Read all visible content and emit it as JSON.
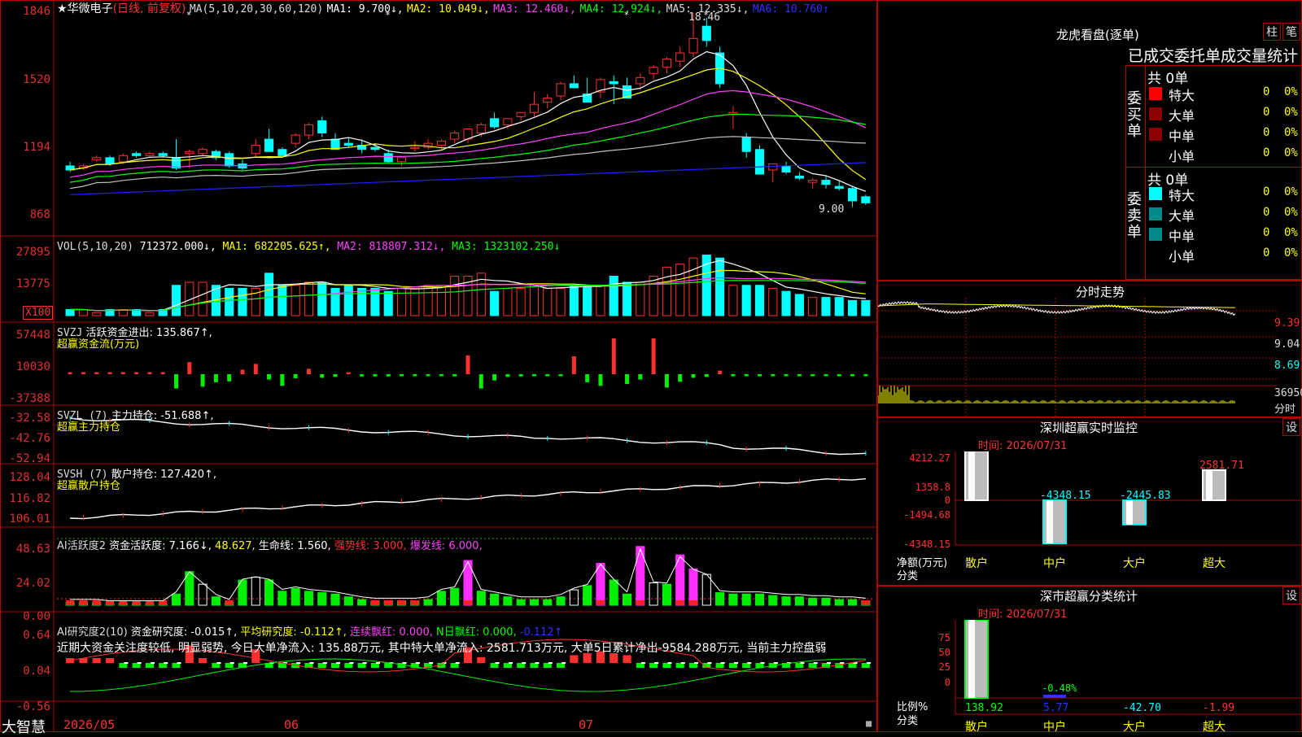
{
  "colors": {
    "up": "#ff3030",
    "down": "#00ffff",
    "grid": "#b00000",
    "axis": "#e03030",
    "text": "#dddddd",
    "ma1": "#ffffff",
    "ma2": "#ffff00",
    "ma3": "#ff40ff",
    "ma4": "#00ff00",
    "ma5": "#c0c0c0",
    "ma6": "#2020ff",
    "green": "#00ee00",
    "magenta": "#ff30ff"
  },
  "header": {
    "star": "★",
    "stock_name": "华微电子",
    "mode": "(日线, 前复权)",
    "ma_label": "MA(5,10,20,30,60,120)",
    "ma1": "MA1: 9.700↓,",
    "ma2": "MA2: 10.049↓,",
    "ma3": "MA3: 12.460↓,",
    "ma4": "MA4: 12.924↓,",
    "ma5": "MA5: 12.335↓,",
    "ma6": "MA6: 10.760↑"
  },
  "price_axis": [
    "1846",
    "1520",
    "1194",
    "868"
  ],
  "price_annotations": {
    "high": "18.46",
    "low": "9.00"
  },
  "vol": {
    "label": "VOL(5,10,20)",
    "value": "712372.000↓,",
    "ma1": "MA1: 682205.625↑,",
    "ma2": "MA2: 818807.312↓,",
    "ma3": "MA3: 1323102.250↓",
    "axis": [
      "27895",
      "13775"
    ],
    "unit": "X100"
  },
  "svzj": {
    "label": "SVZJ",
    "line1": "活跃资金进出: 135.867↑,",
    "line2": "超赢资金流(万元)",
    "axis": [
      "57448",
      "10030",
      "-37388"
    ]
  },
  "svzl": {
    "label": "SVZL (7)",
    "line1": "主力持仓: -51.688↑,",
    "line2": "超赢主力持仓",
    "axis": [
      "-32.58",
      "-42.76",
      "-52.94"
    ]
  },
  "svsh": {
    "label": "SVSH (7)",
    "line1": "散户持仓: 127.420↑,",
    "line2": "超赢散户持仓",
    "axis": [
      "128.04",
      "116.82",
      "106.01"
    ]
  },
  "ai1": {
    "label": "AI活跃度2",
    "a": "资金活跃度: 7.166↓,",
    "b": "48.627,",
    "c": "生命线: 1.560,",
    "d": "强势线: 3.000,",
    "e": "爆发线: 6.000,",
    "axis": [
      "48.63",
      "24.02",
      "0.00"
    ]
  },
  "ai2": {
    "label": "AI研究度2(10)",
    "a": "资金研究度: -0.015↑,",
    "b": "平均研究度: -0.112↑,",
    "c": "连续飘红: 0.000,",
    "d": "N日飘红: 0.000,",
    "e": "-0.112↑",
    "comment": "近期大资金关注度较低, 明显弱势, 今日大单净流入: 135.88万元, 其中特大单净流入: 2581.713万元, 大单5日累计净出-9584.288万元, 当前主力控盘弱",
    "axis": [
      "0.64",
      "0.04",
      "-0.56"
    ]
  },
  "date_axis": {
    "d1": "2026/05",
    "d2": "06",
    "d3": "07"
  },
  "brand": "大智慧",
  "right": {
    "lhb_title": "龙虎看盘(逐单)",
    "btn1": "柱",
    "btn2": "笔",
    "tabs": "已成交委托单成交量统计",
    "buy_side": "委买单",
    "sell_side": "委卖单",
    "buy_total": "共 0单",
    "sell_total": "共 0单",
    "rows": [
      "特大",
      "大单",
      "中单",
      "小单"
    ],
    "zero": "0",
    "pct": "0%",
    "fs_title": "分时走势",
    "fs_axis": [
      "9.39",
      "9.04",
      "8.69"
    ],
    "fs_vol": "36950",
    "fs_unit": "分时",
    "sz_title": "深圳超赢实时监控",
    "sz_btn": "设",
    "sz_time": "时间: 2026/07/31",
    "sz_axis": [
      "4212.27",
      "1358.8",
      "0",
      "-1494.68",
      "-4348.15"
    ],
    "sz_values": [
      "4212.27",
      "-4348.15",
      "-2445.83",
      "2581.71"
    ],
    "sz_unit1": "净额(万元)",
    "sz_unit2": "分类",
    "cats": [
      "散户",
      "中户",
      "大户",
      "超大"
    ],
    "ss_title": "深市超赢分类统计",
    "ss_btn": "设",
    "ss_time": "时间: 2026/07/31",
    "ss_axis": [
      "75",
      "50",
      "25",
      "0"
    ],
    "ss_bar_label": "-0.48%",
    "ss_values": [
      "138.92",
      "5.77",
      "-42.70",
      "-1.99"
    ],
    "ss_unit1": "比例%",
    "ss_unit2": "分类"
  },
  "chart_data": {
    "type": "candlestick",
    "candles": [
      [
        11.0,
        11.2,
        10.7,
        10.8
      ],
      [
        10.9,
        11.1,
        10.8,
        11.0
      ],
      [
        11.3,
        11.5,
        11.2,
        11.4
      ],
      [
        11.4,
        11.5,
        11.0,
        11.1
      ],
      [
        11.2,
        11.6,
        11.1,
        11.5
      ],
      [
        11.6,
        11.7,
        11.4,
        11.5
      ],
      [
        11.5,
        11.7,
        11.4,
        11.6
      ],
      [
        11.6,
        11.7,
        11.4,
        11.5
      ],
      [
        11.4,
        12.3,
        10.8,
        10.9
      ],
      [
        11.6,
        11.8,
        10.9,
        11.7
      ],
      [
        11.6,
        11.9,
        11.5,
        11.8
      ],
      [
        11.7,
        11.8,
        11.3,
        11.4
      ],
      [
        11.6,
        11.7,
        10.9,
        11.0
      ],
      [
        11.1,
        11.3,
        10.8,
        10.9
      ],
      [
        11.6,
        12.3,
        11.4,
        12.0
      ],
      [
        12.3,
        12.8,
        12.0,
        11.7
      ],
      [
        11.8,
        11.9,
        11.5,
        11.5
      ],
      [
        12.1,
        12.6,
        11.9,
        12.5
      ],
      [
        12.5,
        13.1,
        12.3,
        13.0
      ],
      [
        13.2,
        13.4,
        12.4,
        12.6
      ],
      [
        12.3,
        12.6,
        11.8,
        11.8
      ],
      [
        12.1,
        12.4,
        11.9,
        12.0
      ],
      [
        12.0,
        12.3,
        11.6,
        11.8
      ],
      [
        11.9,
        12.1,
        11.7,
        11.8
      ],
      [
        11.6,
        11.8,
        11.1,
        11.2
      ],
      [
        11.2,
        11.4,
        11.0,
        11.4
      ],
      [
        11.9,
        12.2,
        11.7,
        11.9
      ],
      [
        11.9,
        12.3,
        11.8,
        12.1
      ],
      [
        12.0,
        12.3,
        11.8,
        12.2
      ],
      [
        12.3,
        12.7,
        12.1,
        12.6
      ],
      [
        12.3,
        12.8,
        12.1,
        12.8
      ],
      [
        12.6,
        13.1,
        12.4,
        13.0
      ],
      [
        13.3,
        13.6,
        12.8,
        12.9
      ],
      [
        13.0,
        13.3,
        12.8,
        13.3
      ],
      [
        13.4,
        13.6,
        13.2,
        13.6
      ],
      [
        13.6,
        14.6,
        13.4,
        14.0
      ],
      [
        14.1,
        14.5,
        13.8,
        14.3
      ],
      [
        14.4,
        15.1,
        14.2,
        15.0
      ],
      [
        15.0,
        15.4,
        14.8,
        14.8
      ],
      [
        14.5,
        15.3,
        14.2,
        14.1
      ],
      [
        14.6,
        15.3,
        14.3,
        15.2
      ],
      [
        15.1,
        15.4,
        14.0,
        15.0
      ],
      [
        14.9,
        15.3,
        14.4,
        14.3
      ],
      [
        15.0,
        15.5,
        14.7,
        15.3
      ],
      [
        15.5,
        15.9,
        15.2,
        15.8
      ],
      [
        15.8,
        16.3,
        15.5,
        16.2
      ],
      [
        16.1,
        16.8,
        15.8,
        16.5
      ],
      [
        16.5,
        18.46,
        16.3,
        17.2
      ],
      [
        17.8,
        18.2,
        16.8,
        17.1
      ],
      [
        16.5,
        16.8,
        14.8,
        15.0
      ],
      [
        13.5,
        13.9,
        12.8,
        13.6
      ],
      [
        12.4,
        12.6,
        11.4,
        11.7
      ],
      [
        11.8,
        12.0,
        10.6,
        10.6
      ],
      [
        10.8,
        11.0,
        10.2,
        11.1
      ],
      [
        11.0,
        11.2,
        10.6,
        10.7
      ],
      [
        10.5,
        10.7,
        10.3,
        10.4
      ],
      [
        10.2,
        10.4,
        9.9,
        10.3
      ],
      [
        10.3,
        10.5,
        9.9,
        10.1
      ],
      [
        10.0,
        10.3,
        9.8,
        9.9
      ],
      [
        9.9,
        10.0,
        9.0,
        9.3
      ],
      [
        9.5,
        9.6,
        9.1,
        9.2
      ]
    ],
    "volumes": [
      2,
      2,
      1,
      2,
      2,
      2,
      1,
      2,
      10,
      11,
      11,
      10,
      9,
      9,
      9,
      14,
      10,
      10,
      11,
      11,
      9,
      10,
      9,
      9,
      8,
      9,
      9,
      10,
      10,
      13,
      13,
      14,
      8,
      9,
      9,
      10,
      9,
      9,
      10,
      10,
      10,
      13,
      11,
      11,
      13,
      16,
      17,
      19,
      20,
      19,
      10,
      10,
      10,
      9,
      8,
      7,
      6,
      6,
      6,
      5,
      5
    ],
    "svzj": [
      0,
      0,
      0,
      0,
      0,
      0,
      0,
      0,
      -32,
      27,
      -28,
      -18,
      -16,
      10,
      23,
      -12,
      -26,
      -9,
      12,
      -8,
      -6,
      0,
      -5,
      -5,
      -5,
      -4,
      -4,
      -4,
      -4,
      -5,
      42,
      -32,
      -14,
      -6,
      -5,
      -4,
      -4,
      -3,
      40,
      -18,
      -26,
      80,
      -22,
      -12,
      80,
      -30,
      -17,
      -8,
      -6,
      8,
      -4,
      -3,
      -4,
      -4,
      -3,
      -3,
      -3,
      -3,
      -2,
      -2,
      -2
    ],
    "ai1": [
      2,
      2,
      2,
      1,
      1,
      1,
      1,
      1,
      8,
      24,
      15,
      6,
      2,
      18,
      20,
      18,
      10,
      12,
      10,
      9,
      8,
      6,
      4,
      3,
      3,
      3,
      3,
      4,
      10,
      12,
      32,
      10,
      8,
      6,
      4,
      4,
      4,
      6,
      11,
      14,
      30,
      18,
      8,
      42,
      16,
      15,
      36,
      26,
      22,
      9,
      8,
      8,
      8,
      7,
      6,
      6,
      5,
      5,
      4,
      4,
      3
    ],
    "ai2": [
      0.04,
      0.04,
      0.03,
      0.04,
      0.0,
      0.0,
      0.0,
      0.0,
      0.0,
      0.18,
      0.05,
      -0.03,
      0.0,
      -0.02,
      0.14,
      -0.02,
      -0.02,
      0.0,
      0.0,
      0.0,
      0.0,
      0.0,
      0.0,
      0.0,
      0.0,
      0.0,
      0.0,
      0.0,
      0.0,
      0.0,
      0.16,
      0.06,
      0.0,
      0.0,
      0.0,
      0.0,
      0.0,
      0.0,
      0.08,
      0.1,
      0.12,
      0.1,
      0.08,
      -0.02,
      0.0,
      0.0,
      0.0,
      0.0,
      0.0,
      0.0,
      0.0,
      0.0,
      0.0,
      0.0,
      0.0,
      0.0,
      0.0,
      0.0,
      0.0,
      0.0,
      0.0
    ],
    "sz_values": [
      4212.27,
      -4348.15,
      -2445.83,
      2581.71
    ],
    "ss_values": [
      138.92,
      5.77,
      -42.7,
      -1.99
    ]
  }
}
